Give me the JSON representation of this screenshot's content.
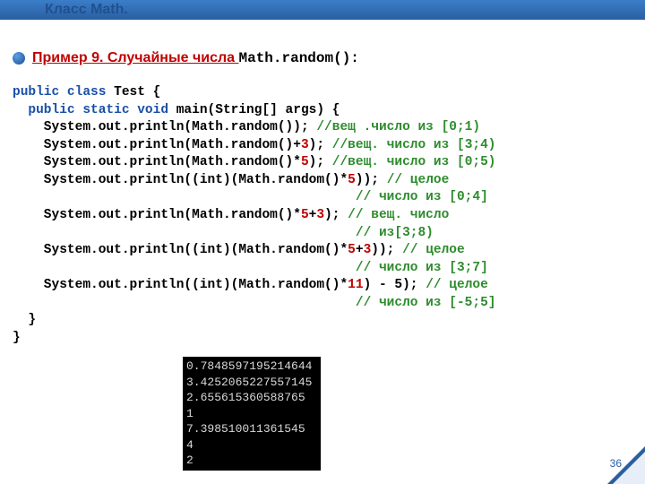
{
  "header": {
    "title": "Класс Math."
  },
  "example": {
    "label": "Пример 9. Случайные числа ",
    "code": "Math.random():"
  },
  "code": {
    "l01a": "public class",
    "l01b": " Test {",
    "l02a": "  public static void",
    "l02b": " main(String[] args) {",
    "l03a": "    System.out.println(Math.random()); ",
    "l03c": "//вещ .число из [0;1)",
    "l04a": "    System.out.println(Math.random()+",
    "l04n": "3",
    "l04b": "); ",
    "l04c": "//вещ. число из [3;4)",
    "l05a": "    System.out.println(Math.random()*",
    "l05n": "5",
    "l05b": "); ",
    "l05c": "//вещ. число из [0;5)",
    "l06a": "    System.out.println((int)(Math.random()*",
    "l06n": "5",
    "l06b": ")); ",
    "l06c": "// целое",
    "l07c": "                                            // число из [0;4]",
    "l08a": "    System.out.println(Math.random()*",
    "l08n1": "5",
    "l08m": "+",
    "l08n2": "3",
    "l08b": "); ",
    "l08c": "// вещ. число",
    "l09c": "                                            // из[3;8)",
    "l10a": "    System.out.println((int)(Math.random()*",
    "l10n1": "5",
    "l10m": "+",
    "l10n2": "3",
    "l10b": ")); ",
    "l10c": "// целое",
    "l11c": "                                            // число из [3;7]",
    "l12a": "    System.out.println((int)(Math.random()*",
    "l12n": "11",
    "l12b": ") - 5); ",
    "l12c": "// целое",
    "l13c": "                                            // число из [-5;5]",
    "l14": "  }",
    "l15": "}"
  },
  "output": {
    "l1": "0.7848597195214644",
    "l2": "3.4252065227557145",
    "l3": "2.655615360588765",
    "l4": "1",
    "l5": "7.398510011361545",
    "l6": "4",
    "l7": "2"
  },
  "pagenum": "36"
}
